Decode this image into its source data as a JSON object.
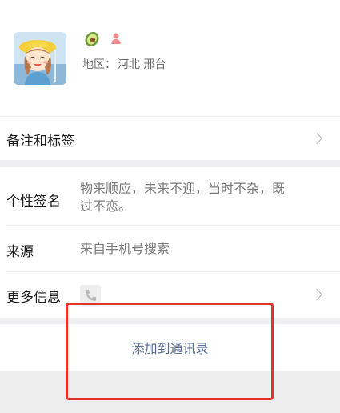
{
  "profile": {
    "avatar_icon": "cartoon-girl-avatar",
    "badge_icon": "avocado-icon",
    "gender_icon": "female-user-icon",
    "region_label": "地区：",
    "region_value": "河北 邢台"
  },
  "rows": {
    "remark_label": "备注和标签",
    "signature_label": "个性签名",
    "signature_value_line1": "物来顺应，未来不迎，当时不杂，既",
    "signature_value_line2": "过不恋。",
    "source_label": "来源",
    "source_value": "来自手机号搜索",
    "more_label": "更多信息",
    "more_icon": "phone-icon"
  },
  "actions": {
    "add_contact_label": "添加到通讯录"
  },
  "colors": {
    "link": "#576b95",
    "highlight": "#e8302b",
    "gap": "#efeff2"
  }
}
